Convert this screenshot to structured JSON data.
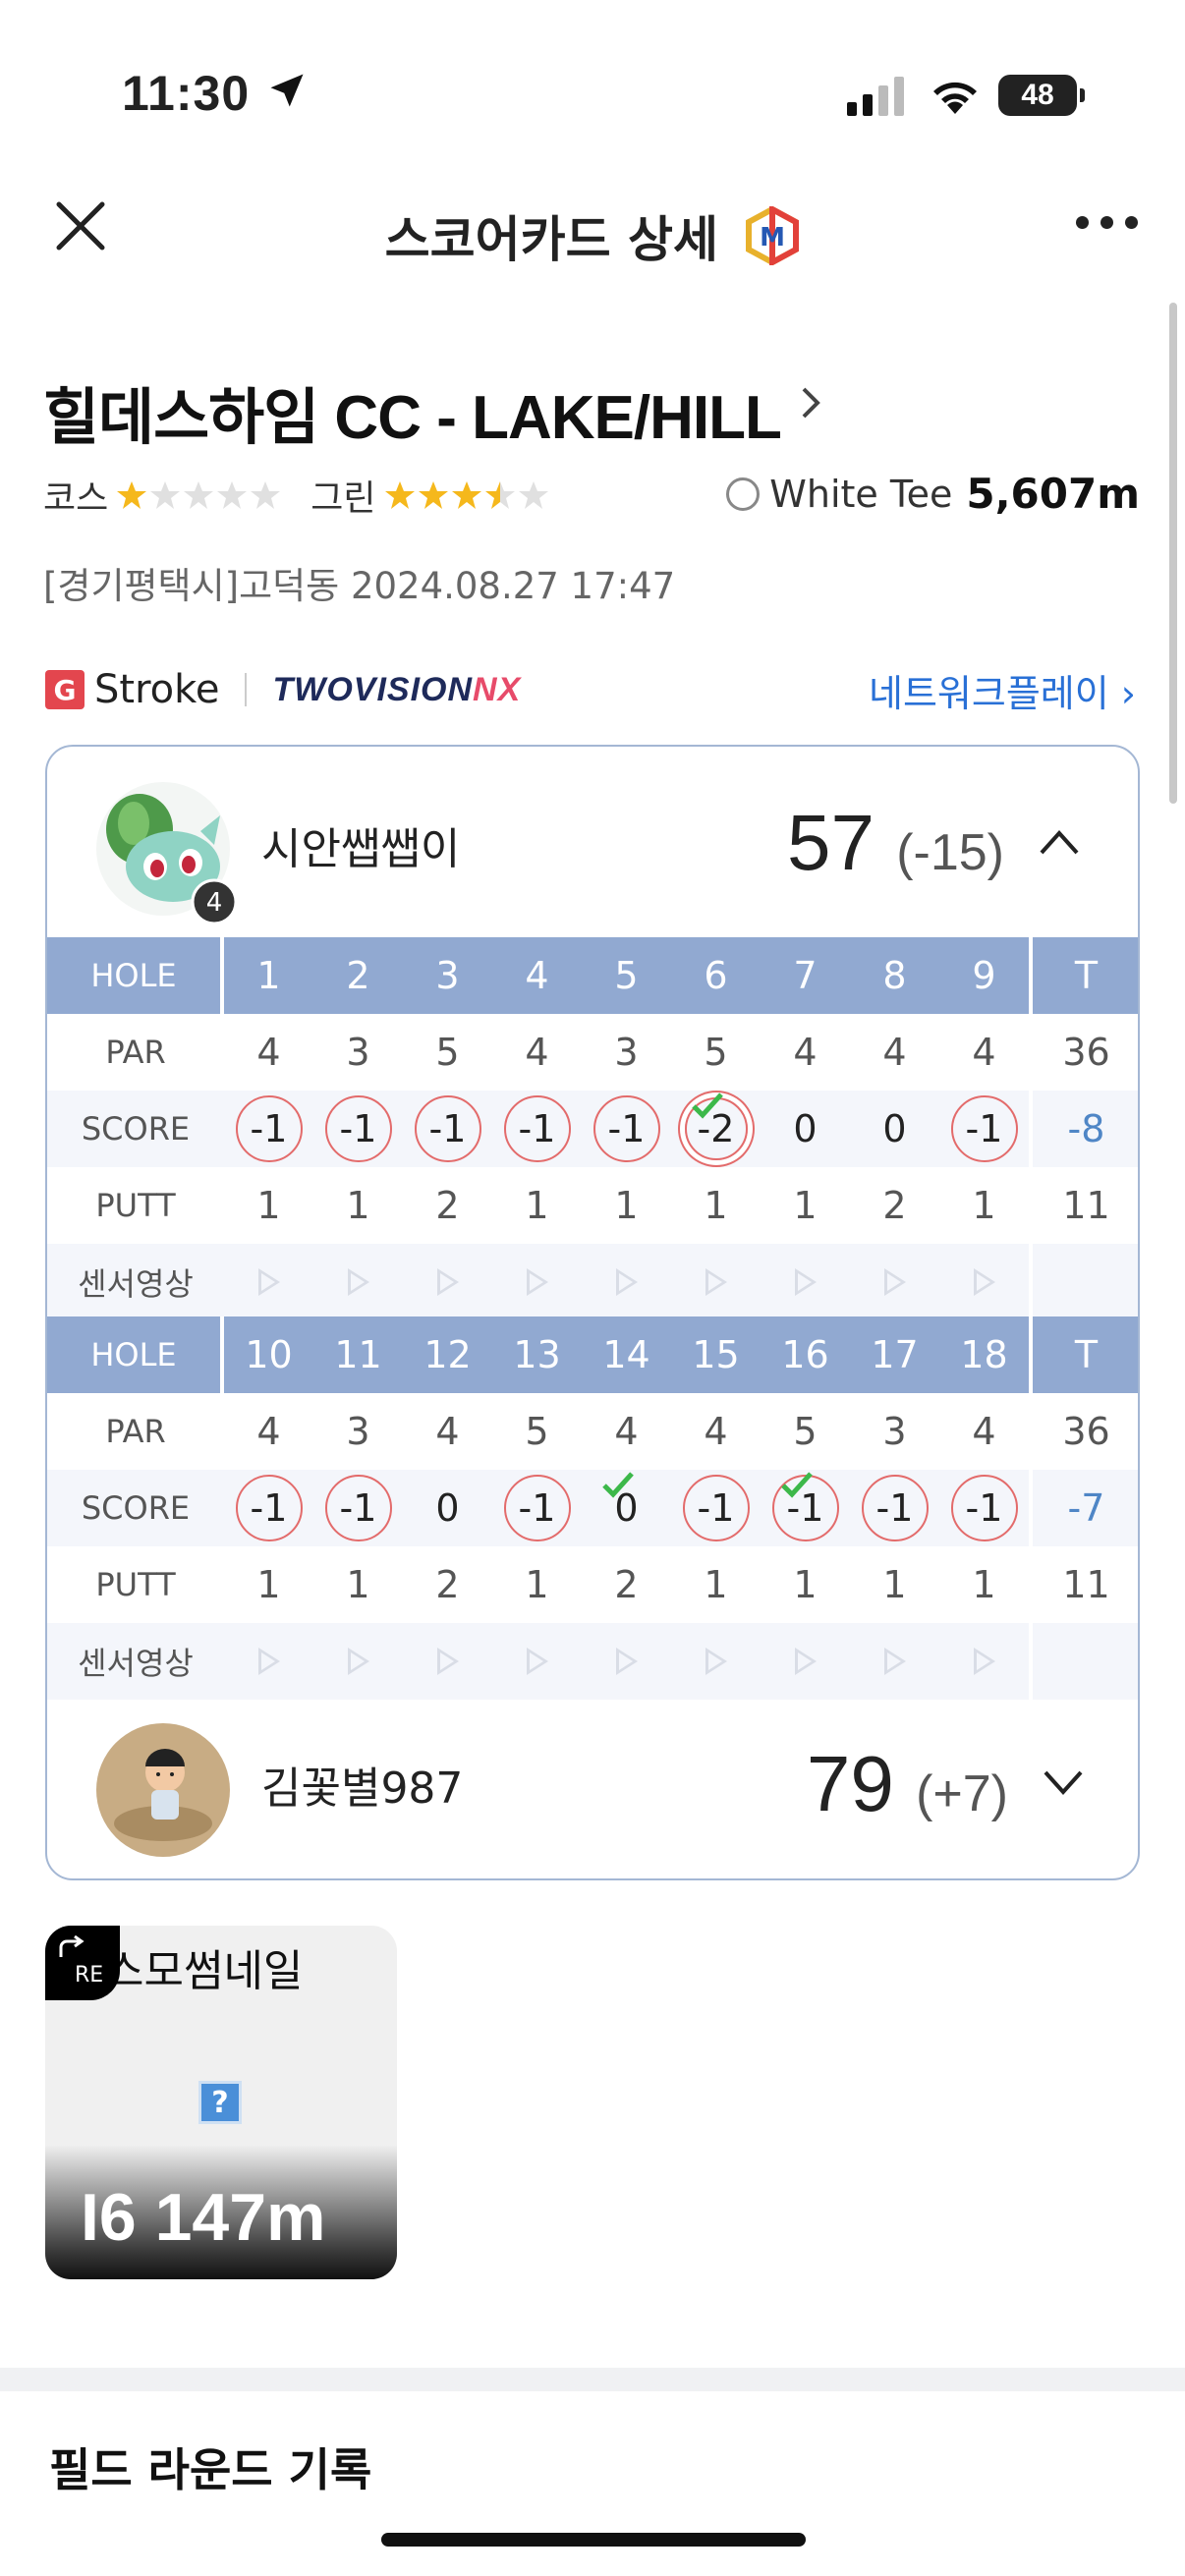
{
  "status": {
    "time": "11:30",
    "battery": "48"
  },
  "nav": {
    "title": "스코어카드 상세",
    "logo_letter": "M"
  },
  "course": {
    "name": "힐데스하임 CC - LAKE/HILL",
    "course_label": "코스",
    "course_stars": 1,
    "green_label": "그린",
    "green_stars": 3.5,
    "tee_name": "White Tee",
    "tee_distance": "5,607m",
    "place_date": "[경기평택시]고덕동 2024.08.27 17:47"
  },
  "brand": {
    "g_badge": "G",
    "stroke": "Stroke",
    "twovision_a": "TWOVISION",
    "twovision_b": "NX",
    "network_play": "네트워크플레이"
  },
  "player1": {
    "name": "시안쌥쌥이",
    "badge": "4",
    "total": "57",
    "diff": "(-15)",
    "front": {
      "hole_label": "HOLE",
      "par_label": "PAR",
      "score_label": "SCORE",
      "putt_label": "PUTT",
      "sensor_label": "센서영상",
      "holes": [
        "1",
        "2",
        "3",
        "4",
        "5",
        "6",
        "7",
        "8",
        "9"
      ],
      "hole_total": "T",
      "par": [
        "4",
        "3",
        "5",
        "4",
        "3",
        "5",
        "4",
        "4",
        "4"
      ],
      "par_total": "36",
      "score": [
        "-1",
        "-1",
        "-1",
        "-1",
        "-1",
        "-2",
        "0",
        "0",
        "-1"
      ],
      "score_total": "-8",
      "putt": [
        "1",
        "1",
        "2",
        "1",
        "1",
        "1",
        "1",
        "2",
        "1"
      ],
      "putt_total": "11"
    },
    "back": {
      "hole_label": "HOLE",
      "par_label": "PAR",
      "score_label": "SCORE",
      "putt_label": "PUTT",
      "sensor_label": "센서영상",
      "holes": [
        "10",
        "11",
        "12",
        "13",
        "14",
        "15",
        "16",
        "17",
        "18"
      ],
      "hole_total": "T",
      "par": [
        "4",
        "3",
        "4",
        "5",
        "4",
        "4",
        "5",
        "3",
        "4"
      ],
      "par_total": "36",
      "score": [
        "-1",
        "-1",
        "0",
        "-1",
        "0",
        "-1",
        "-1",
        "-1",
        "-1"
      ],
      "score_total": "-7",
      "putt": [
        "1",
        "1",
        "2",
        "1",
        "2",
        "1",
        "1",
        "1",
        "1"
      ],
      "putt_total": "11"
    }
  },
  "player2": {
    "name": "김꽃별987",
    "total": "79",
    "diff": "(+7)"
  },
  "thumbnail": {
    "re_label": "RE",
    "name": "스모썸네일",
    "icon": "?",
    "distance": "I6 147m"
  },
  "section": {
    "title": "필드 라운드 기록"
  }
}
